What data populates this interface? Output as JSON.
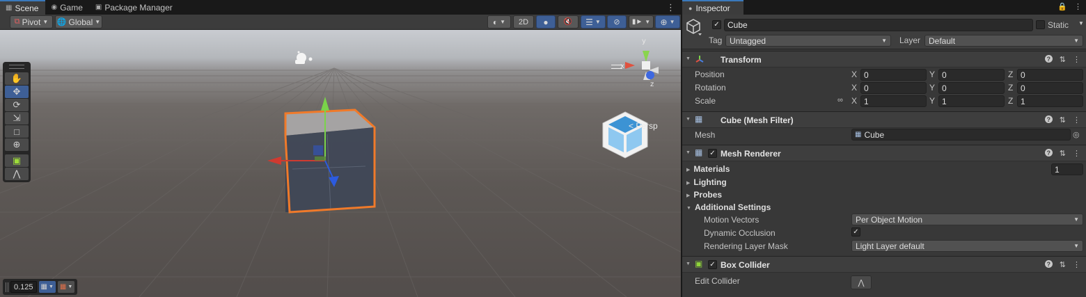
{
  "scene": {
    "tabs": [
      {
        "label": "Scene",
        "icon": "grid-icon"
      },
      {
        "label": "Game",
        "icon": "gamepad-icon"
      },
      {
        "label": "Package Manager",
        "icon": "package-icon"
      }
    ],
    "toolbar": {
      "pivot_label": "Pivot",
      "global_label": "Global",
      "mode_2d_label": "2D"
    },
    "tools": [
      "hand-tool",
      "move-tool",
      "rotate-tool",
      "scale-tool",
      "rect-tool",
      "transform-tool",
      "custom-editor-tool",
      "collider-edit-tool"
    ],
    "snap_value": "0.125",
    "persp_label": "< Persp",
    "gizmo_axes": {
      "x": "x",
      "y": "y",
      "z": "z"
    }
  },
  "inspector": {
    "tab_label": "Inspector",
    "object": {
      "name": "Cube",
      "static_label": "Static",
      "tag_label": "Tag",
      "tag_value": "Untagged",
      "layer_label": "Layer",
      "layer_value": "Default"
    },
    "transform": {
      "title": "Transform",
      "position_label": "Position",
      "rotation_label": "Rotation",
      "scale_label": "Scale",
      "position": [
        "0",
        "0",
        "0"
      ],
      "rotation": [
        "0",
        "0",
        "0"
      ],
      "scale": [
        "1",
        "1",
        "1"
      ],
      "axis_labels": [
        "X",
        "Y",
        "Z"
      ]
    },
    "mesh_filter": {
      "title": "Cube (Mesh Filter)",
      "mesh_label": "Mesh",
      "mesh_value": "Cube"
    },
    "mesh_renderer": {
      "title": "Mesh Renderer",
      "materials_label": "Materials",
      "materials_count": "1",
      "lighting_label": "Lighting",
      "probes_label": "Probes",
      "additional_label": "Additional Settings",
      "motion_vectors_label": "Motion Vectors",
      "motion_vectors_value": "Per Object Motion",
      "dynamic_occlusion_label": "Dynamic Occlusion",
      "rendering_layer_label": "Rendering Layer Mask",
      "rendering_layer_value": "Light Layer default"
    },
    "box_collider": {
      "title": "Box Collider",
      "edit_collider_label": "Edit Collider"
    }
  },
  "colors": {
    "selection_blue": "#3e5f96",
    "outline_orange": "#f07a2a",
    "panel_bg": "#383838"
  }
}
